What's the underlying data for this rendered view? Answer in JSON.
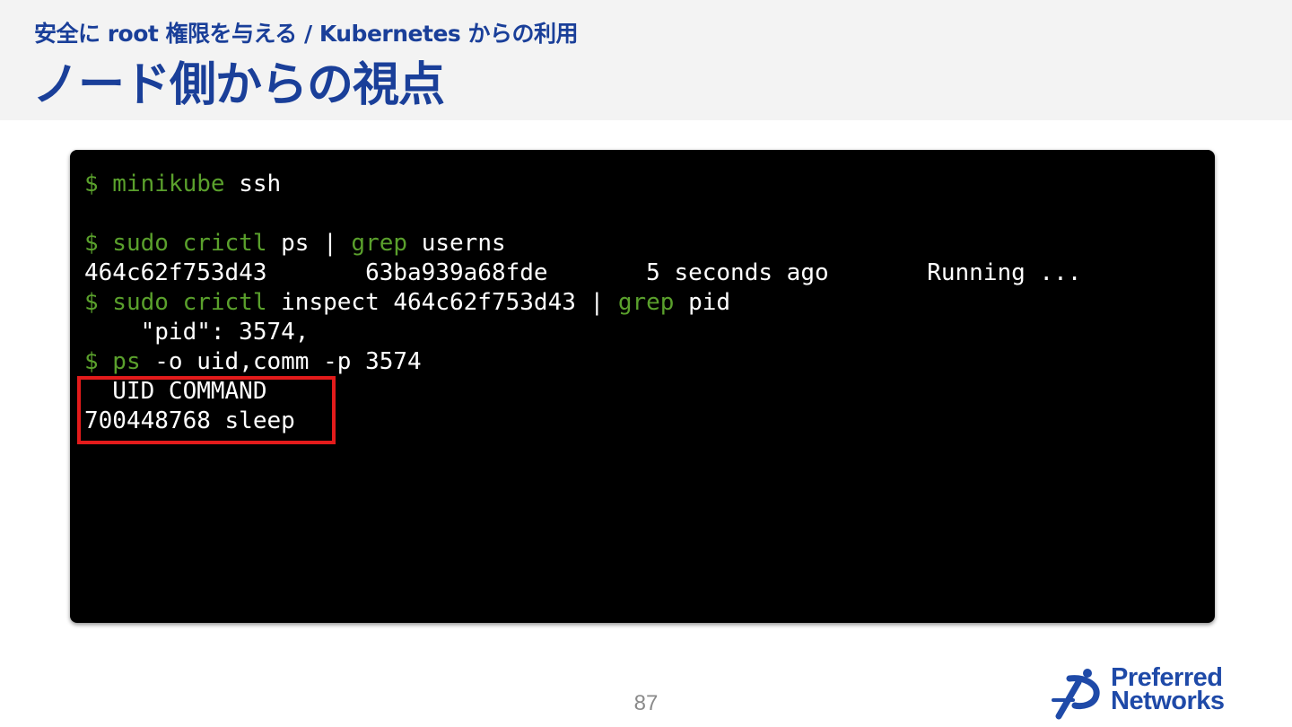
{
  "slide": {
    "subtitle": "安全に root 権限を与える / Kubernetes からの利用",
    "title": "ノード側からの視点",
    "page_number": "87"
  },
  "terminal": {
    "l1_prompt": "$ minikube",
    "l1_rest": " ssh",
    "l2_prompt": "$ sudo crictl",
    "l2_a": " ps | ",
    "l2_grep": "grep",
    "l2_b": " userns",
    "l3": "464c62f753d43       63ba939a68fde       5 seconds ago       Running ...",
    "l4_prompt": "$ sudo crictl",
    "l4_a": " inspect 464c62f753d43 | ",
    "l4_grep": "grep",
    "l4_b": " pid",
    "l5": "    \"pid\": 3574,",
    "l6_prompt": "$ ps",
    "l6_rest": " -o uid,comm -p 3574",
    "l7": "  UID COMMAND",
    "l8": "700448768 sleep"
  },
  "logo": {
    "line1": "Preferred",
    "line2": "Networks"
  },
  "colors": {
    "title": "#1a3f99",
    "terminal_bg": "#000000",
    "prompt_green": "#5aa02c",
    "highlight_red": "#e31b1b",
    "logo_blue": "#1f4aa8"
  }
}
